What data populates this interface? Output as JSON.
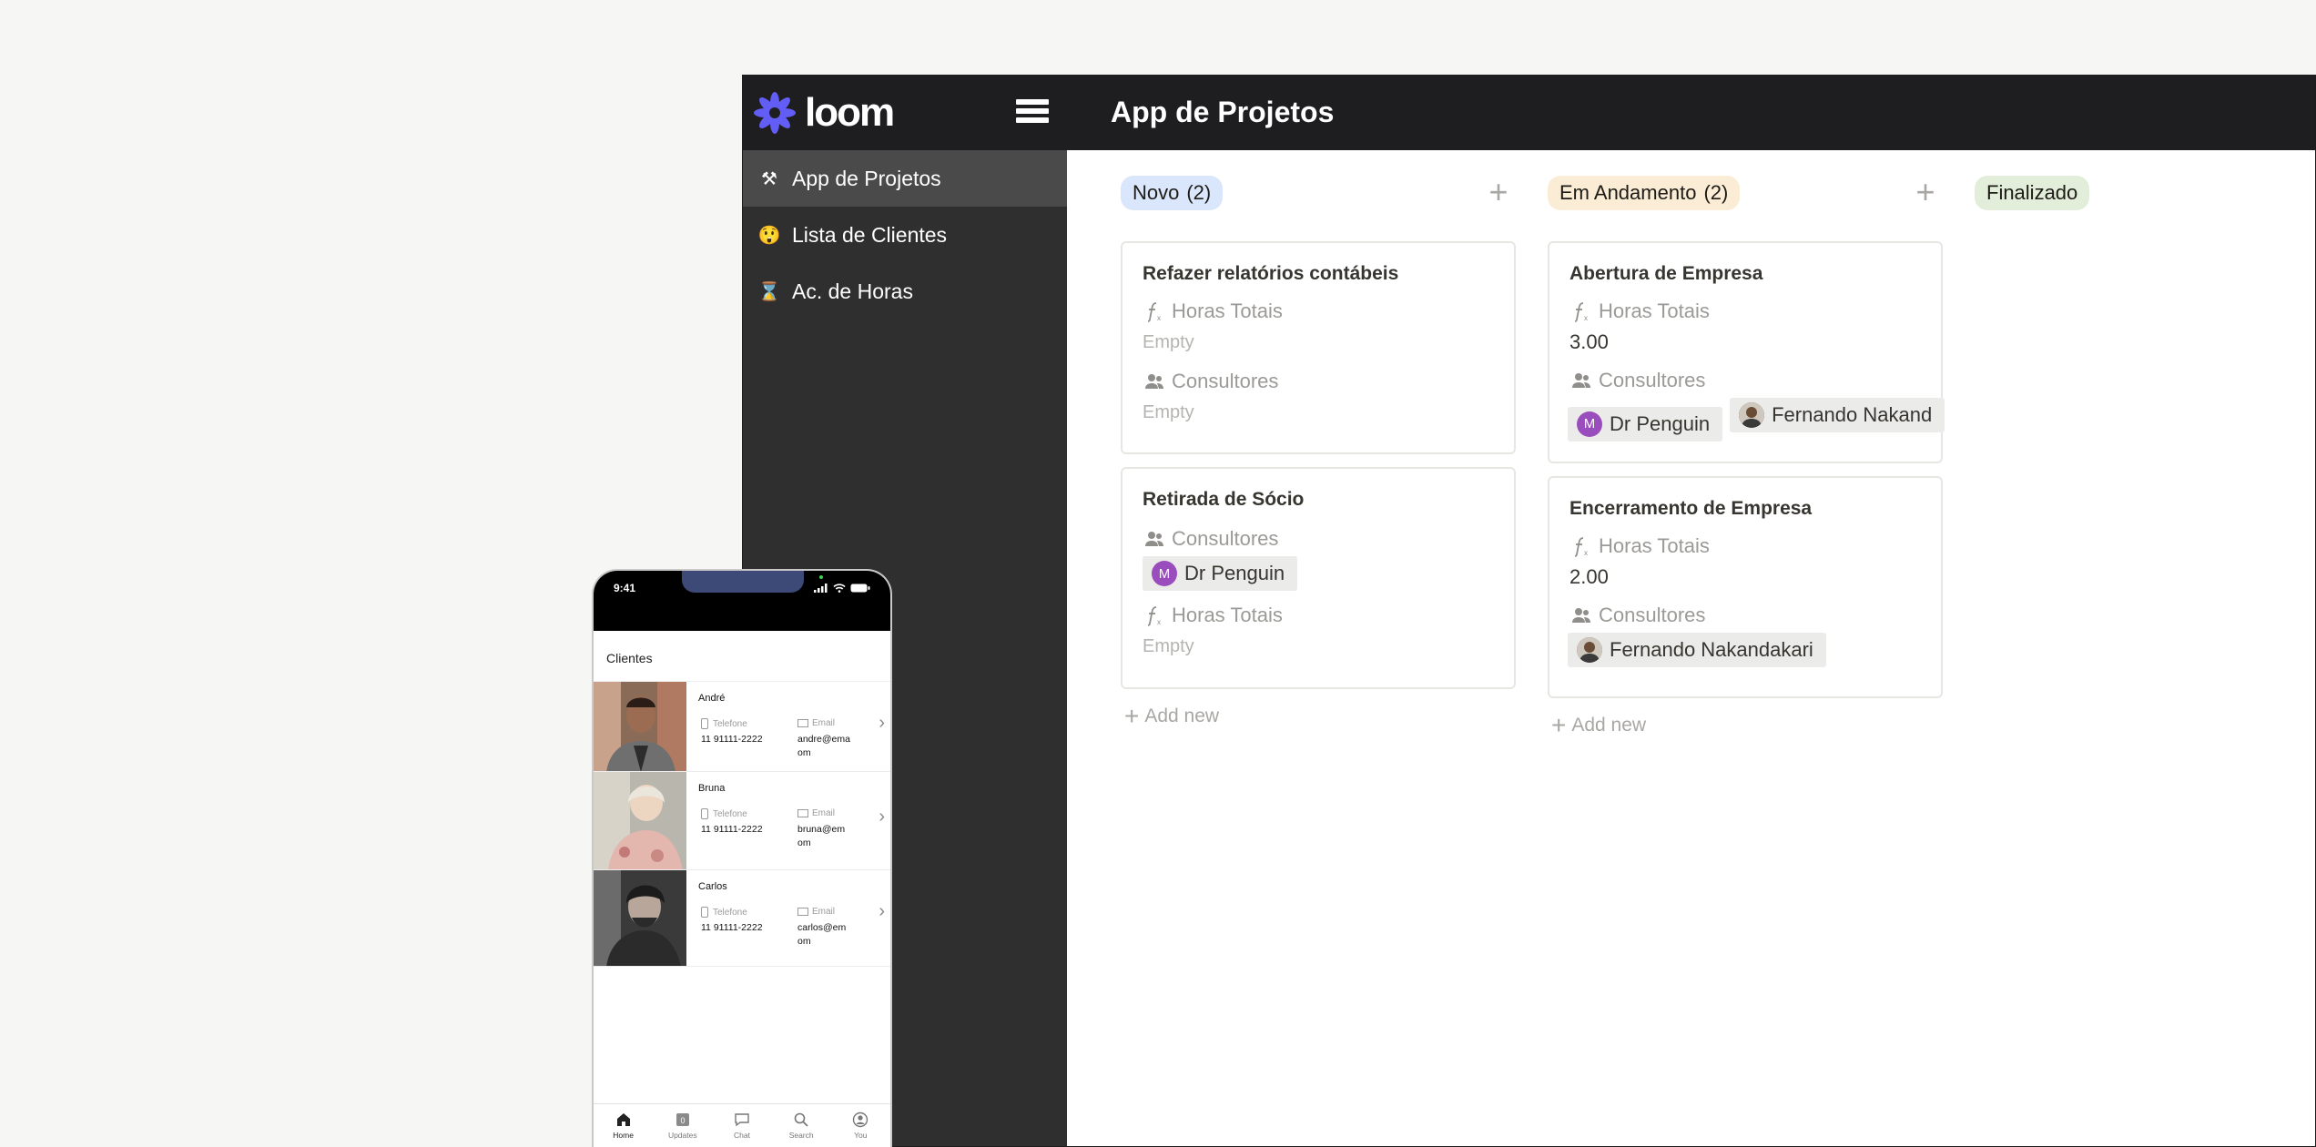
{
  "app": {
    "logo_text": "loom",
    "title": "App de Projetos",
    "accent_color": "#625df5"
  },
  "sidebar": {
    "items": [
      {
        "icon": "hammer-and-pick-icon",
        "label": "App de Projetos",
        "active": true
      },
      {
        "icon": "person-face-icon",
        "label": "Lista de Clientes",
        "active": false
      },
      {
        "icon": "hourglass-icon",
        "label": "Ac. de Horas",
        "active": false
      }
    ]
  },
  "board": {
    "empty_text": "Empty",
    "add_new_label": "Add new",
    "horas_label": "Horas Totais",
    "consultores_label": "Consultores",
    "columns": [
      {
        "name": "Novo",
        "count": "(2)",
        "color": "#d9e6fb",
        "cards": [
          {
            "title": "Refazer relatórios contábeis",
            "horas": "",
            "consultores": []
          },
          {
            "title": "Retirada de Sócio",
            "consultores": [
              {
                "initial": "M",
                "name": "Dr Penguin"
              }
            ],
            "horas": ""
          }
        ]
      },
      {
        "name": "Em Andamento",
        "count": "(2)",
        "color": "#fbecd6",
        "cards": [
          {
            "title": "Abertura de Empresa",
            "horas": "3.00",
            "consultores": [
              {
                "initial": "M",
                "name": "Dr Penguin"
              },
              {
                "initial": "",
                "name": "Fernando Nakand"
              }
            ]
          },
          {
            "title": "Encerramento de Empresa",
            "horas": "2.00",
            "consultores": [
              {
                "initial": "",
                "name": "Fernando Nakandakari"
              }
            ]
          }
        ]
      },
      {
        "name": "Finalizado",
        "count": "",
        "color": "#e2eeda",
        "cards": []
      }
    ]
  },
  "phone": {
    "time": "9:41",
    "title": "Clientes",
    "phone_label": "Telefone",
    "email_label": "Email",
    "clients": [
      {
        "name": "André",
        "phone": "11 91111-2222",
        "email_line1": "andre@ema",
        "email_line2": "om"
      },
      {
        "name": "Bruna",
        "phone": "11 91111-2222",
        "email_line1": "bruna@em",
        "email_line2": "om"
      },
      {
        "name": "Carlos",
        "phone": "11 91111-2222",
        "email_line1": "carlos@em",
        "email_line2": "om"
      }
    ],
    "tabs": [
      {
        "icon": "home-icon",
        "label": "Home"
      },
      {
        "icon": "updates-icon",
        "label": "Updates",
        "badge": "0"
      },
      {
        "icon": "chat-icon",
        "label": "Chat"
      },
      {
        "icon": "search-icon",
        "label": "Search"
      },
      {
        "icon": "user-circle-icon",
        "label": "You"
      }
    ]
  }
}
